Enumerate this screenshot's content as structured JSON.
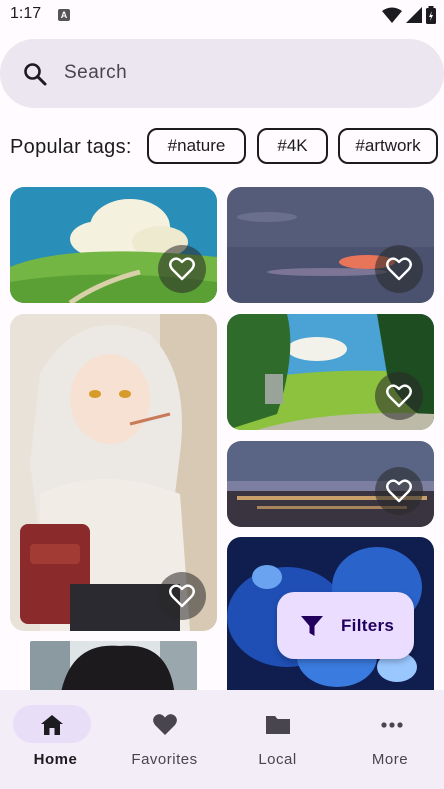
{
  "status_bar": {
    "time": "1:17",
    "notification_icon": "a-icon"
  },
  "search": {
    "placeholder": "Search"
  },
  "tags": {
    "label": "Popular tags:",
    "items": [
      "#nature",
      "#4K",
      "#artwork"
    ]
  },
  "wallpapers": [
    {
      "subject": "green hill with clouds",
      "favorite_icon": "heart-outline-icon"
    },
    {
      "subject": "dusk sky",
      "favorite_icon": "heart-outline-icon"
    },
    {
      "subject": "anime girl with backpack",
      "favorite_icon": "heart-outline-icon"
    },
    {
      "subject": "forest path",
      "favorite_icon": "heart-outline-icon"
    },
    {
      "subject": "city at dusk",
      "favorite_icon": "heart-outline-icon"
    },
    {
      "subject": "blue abstract",
      "favorite_icon": "none"
    },
    {
      "subject": "dark hair portrait",
      "favorite_icon": "none"
    }
  ],
  "fab": {
    "label": "Filters",
    "icon": "filter-icon"
  },
  "nav": {
    "items": [
      {
        "label": "Home",
        "icon": "home-icon",
        "active": true
      },
      {
        "label": "Favorites",
        "icon": "heart-icon",
        "active": false
      },
      {
        "label": "Local",
        "icon": "folder-icon",
        "active": false
      },
      {
        "label": "More",
        "icon": "more-icon",
        "active": false
      }
    ]
  },
  "colors": {
    "background": "#fffbfe",
    "search_bg": "#ece6f0",
    "fab_bg": "#eaddff",
    "nav_bg": "#f3edf7",
    "nav_active_pill": "#e8def8"
  }
}
